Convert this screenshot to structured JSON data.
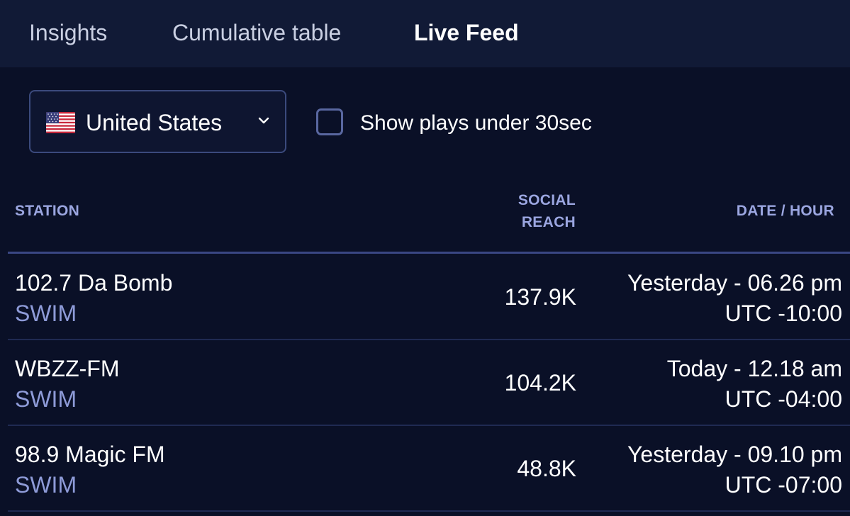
{
  "tabs": [
    {
      "label": "Insights",
      "active": false
    },
    {
      "label": "Cumulative table",
      "active": false
    },
    {
      "label": "Live Feed",
      "active": true
    }
  ],
  "filters": {
    "country": {
      "label": "United States",
      "flag_icon": "us-flag-icon"
    },
    "short_plays": {
      "label": "Show plays under 30sec",
      "checked": false
    }
  },
  "table": {
    "headers": {
      "station": "STATION",
      "reach_line1": "SOCIAL",
      "reach_line2": "REACH",
      "date": "DATE / HOUR"
    },
    "rows": [
      {
        "station": "102.7 Da Bomb",
        "sub": "SWIM",
        "reach": "137.9K",
        "date": "Yesterday - 06.26 pm",
        "tz": "UTC -10:00"
      },
      {
        "station": "WBZZ-FM",
        "sub": "SWIM",
        "reach": "104.2K",
        "date": "Today - 12.18 am",
        "tz": "UTC -04:00"
      },
      {
        "station": "98.9 Magic FM",
        "sub": "SWIM",
        "reach": "48.8K",
        "date": "Yesterday - 09.10 pm",
        "tz": "UTC -07:00"
      }
    ]
  },
  "colors": {
    "background": "#0a1027",
    "tabbar": "#111a36",
    "header_text": "#9ba6e0",
    "secondary_text": "#8e9bd8",
    "border": "#3b4a7d"
  }
}
